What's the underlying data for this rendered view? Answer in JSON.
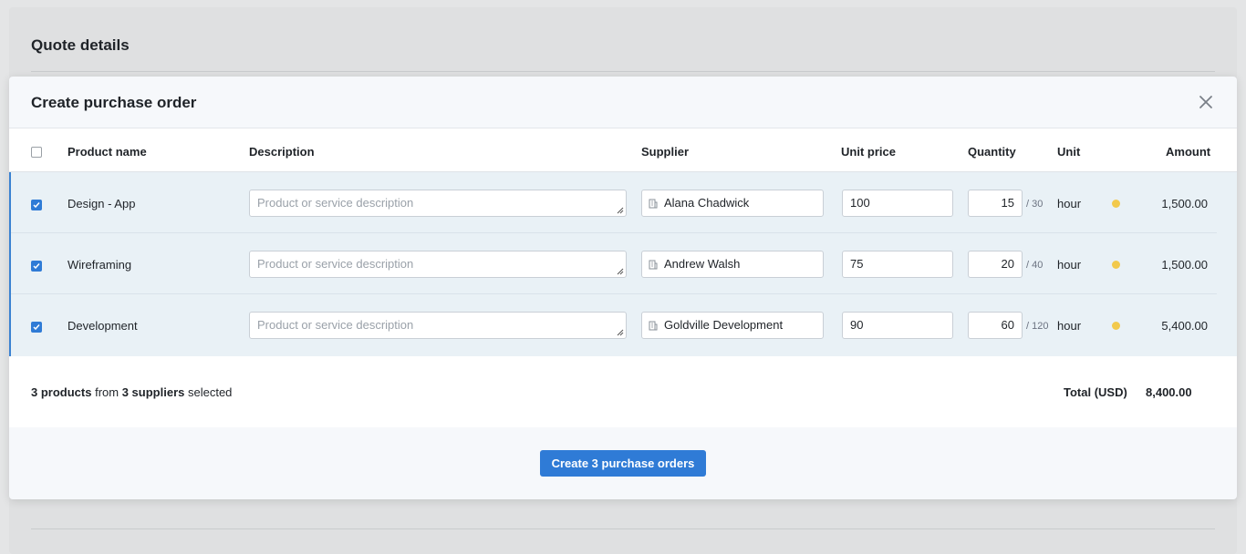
{
  "background": {
    "title": "Quote details"
  },
  "modal": {
    "title": "Create purchase order",
    "columns": {
      "product_name": "Product name",
      "description": "Description",
      "supplier": "Supplier",
      "unit_price": "Unit price",
      "quantity": "Quantity",
      "unit": "Unit",
      "amount": "Amount"
    },
    "rows": [
      {
        "product": "Design - App",
        "description_placeholder": "Product or service description",
        "supplier": "Alana Chadwick",
        "unit_price": "100",
        "quantity": "15",
        "quantity_max": "/ 30",
        "unit": "hour",
        "amount": "1,500.00"
      },
      {
        "product": "Wireframing",
        "description_placeholder": "Product or service description",
        "supplier": "Andrew Walsh",
        "unit_price": "75",
        "quantity": "20",
        "quantity_max": "/ 40",
        "unit": "hour",
        "amount": "1,500.00"
      },
      {
        "product": "Development",
        "description_placeholder": "Product or service description",
        "supplier": "Goldville Development",
        "unit_price": "90",
        "quantity": "60",
        "quantity_max": "/ 120",
        "unit": "hour",
        "amount": "5,400.00"
      }
    ],
    "summary": {
      "products_count": "3 products",
      "from_text": "from",
      "suppliers_count": "3 suppliers",
      "selected_text": "selected",
      "total_label": "Total (USD)",
      "total_value": "8,400.00"
    },
    "create_button": "Create 3 purchase orders"
  },
  "colors": {
    "accent": "#2f7bd6",
    "status_dot": "#f2c94c",
    "selected_row_bg": "#e9f1f6"
  },
  "icons": [
    "close-icon",
    "building-icon",
    "checkbox-icon",
    "resize-handle-icon"
  ]
}
